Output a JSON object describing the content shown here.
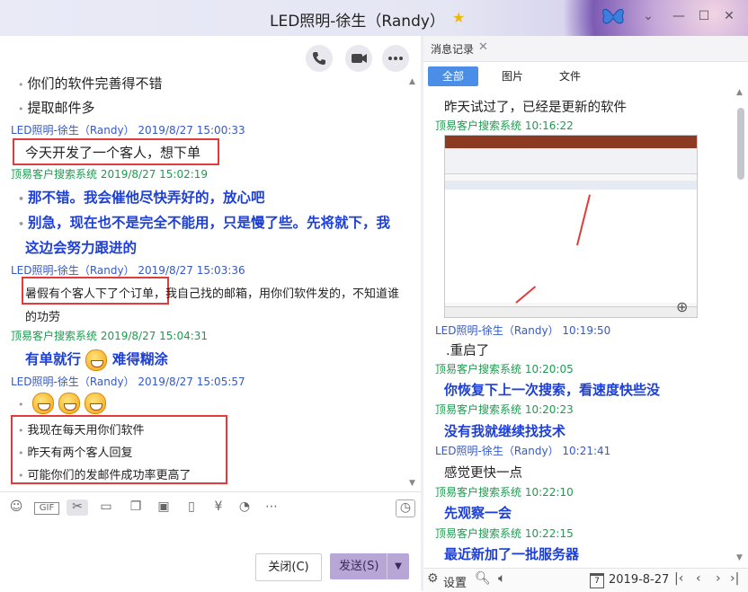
{
  "window": {
    "title": "LED照明-徐生（Randy）",
    "controls": [
      "chevron-down-icon",
      "minimize-icon",
      "maximize-icon",
      "close-icon"
    ]
  },
  "chat": {
    "messages": [
      {
        "kind": "plain",
        "text": "你们的软件完善得不错"
      },
      {
        "kind": "plain",
        "text": "提取邮件多"
      },
      {
        "kind": "header_led",
        "text": "LED照明-徐生（Randy）  2019/8/27 15:00:33"
      },
      {
        "kind": "plain",
        "text": "今天开发了一个客人，想下单"
      },
      {
        "kind": "header_gs",
        "text": "顶易客户搜索系统 2019/8/27 15:02:19"
      },
      {
        "kind": "blue",
        "text": "那不错。我会催他尽快弄好的，放心吧"
      },
      {
        "kind": "blue",
        "text": "别急，现在也不是完全不能用，只是慢了些。先将就下，我"
      },
      {
        "kind": "blue",
        "text": "这边会努力跟进的"
      },
      {
        "kind": "header_led",
        "text": "LED照明-徐生（Randy）  2019/8/27 15:03:36"
      },
      {
        "kind": "small",
        "text": "暑假有个客人下了个订单，我自己找的邮箱，用你们软件发的，不知道谁"
      },
      {
        "kind": "small",
        "text": "的功劳"
      },
      {
        "kind": "header_gs",
        "text": "顶易客户搜索系统 2019/8/27 15:04:31"
      },
      {
        "kind": "blue",
        "text": "有单就行"
      },
      {
        "kind": "blue",
        "text": "难得糊涂"
      },
      {
        "kind": "header_led",
        "text": "LED照明-徐生（Randy）  2019/8/27 15:05:57"
      },
      {
        "kind": "small",
        "text": "我现在每天用你们软件"
      },
      {
        "kind": "small",
        "text": "昨天有两个客人回复"
      },
      {
        "kind": "small",
        "text": "可能你们的发邮件成功率更高了"
      }
    ],
    "toolbar_icons": [
      "emoji-icon",
      "gif-icon",
      "scissors-icon",
      "folder-icon",
      "file-icon",
      "image-icon",
      "phone-shake-icon",
      "red-packet-icon",
      "voice-icon",
      "more-icon",
      "history-clock-icon"
    ],
    "gif_label": "GIF",
    "close_button": "关闭(C)",
    "send_button": "发送(S)"
  },
  "history": {
    "tab_label": "消息记录",
    "filters": [
      "全部",
      "图片",
      "文件"
    ],
    "entries": [
      {
        "kind": "plain",
        "text": "昨天试过了，已经是更新的软件"
      },
      {
        "kind": "header_gs",
        "text": "顶易客户搜索系统 10:16:22"
      },
      {
        "kind": "header_led",
        "text": "LED照明-徐生（Randy） 10:19:50"
      },
      {
        "kind": "plain",
        "text": ".重启了"
      },
      {
        "kind": "header_gs",
        "text": "顶易客户搜索系统 10:20:05"
      },
      {
        "kind": "blue",
        "text": "你恢复下上一次搜索，看速度快些没"
      },
      {
        "kind": "header_gs",
        "text": "顶易客户搜索系统 10:20:23"
      },
      {
        "kind": "blue",
        "text": "没有我就继续找技术"
      },
      {
        "kind": "header_led",
        "text": "LED照明-徐生（Randy） 10:21:41"
      },
      {
        "kind": "plain",
        "text": "感觉更快一点"
      },
      {
        "kind": "header_gs",
        "text": "顶易客户搜索系统 10:22:10"
      },
      {
        "kind": "blue",
        "text": "先观察一会"
      },
      {
        "kind": "header_gs",
        "text": "顶易客户搜索系统 10:22:15"
      },
      {
        "kind": "blue",
        "text": "最近新加了一批服务器"
      }
    ],
    "settings_label": "设置",
    "date": "2019-8-27",
    "calendar_day": "7"
  }
}
